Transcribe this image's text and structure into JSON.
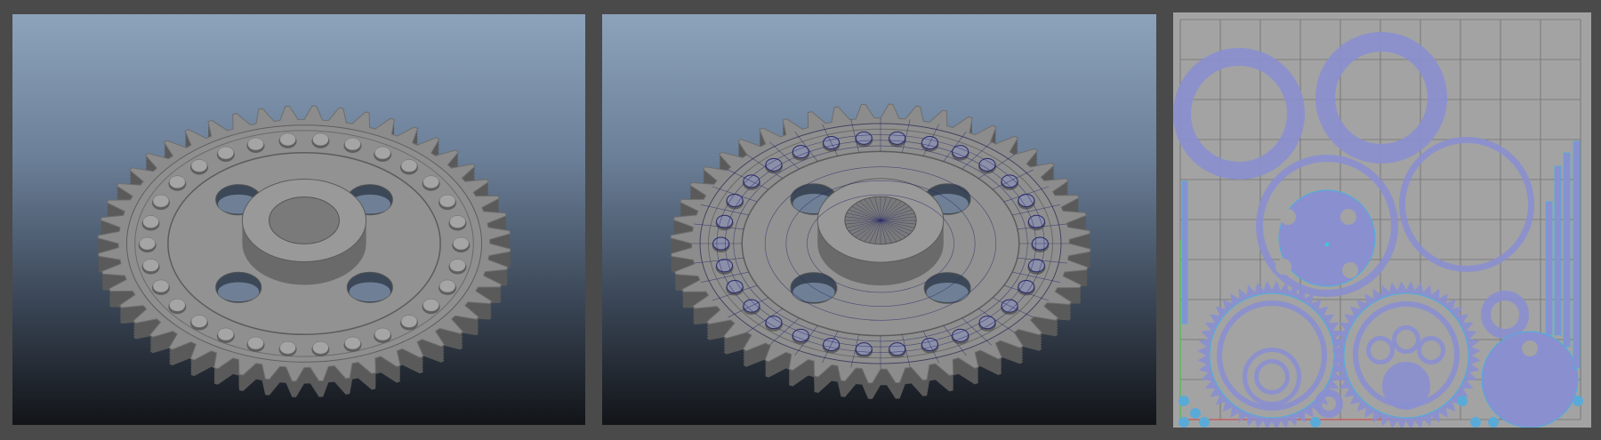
{
  "panels": {
    "shaded": {
      "mode": "smooth-shaded"
    },
    "wireframe": {
      "mode": "wireframe-on-shaded"
    },
    "uv": {
      "mode": "uv-layout"
    }
  },
  "gear": {
    "teeth": 48,
    "bolts": 30,
    "holes": 4
  },
  "colors": {
    "background": "#4a4a4a",
    "gear_top": "#8c8c8c",
    "gear_side": "#5a5a5a",
    "wire": "#2a2a6a",
    "uv_bg": "#a3a3a3",
    "uv_shell": "#8a8fd0",
    "uv_edge": "#4ab0e0",
    "uv_grid": "#707070"
  }
}
